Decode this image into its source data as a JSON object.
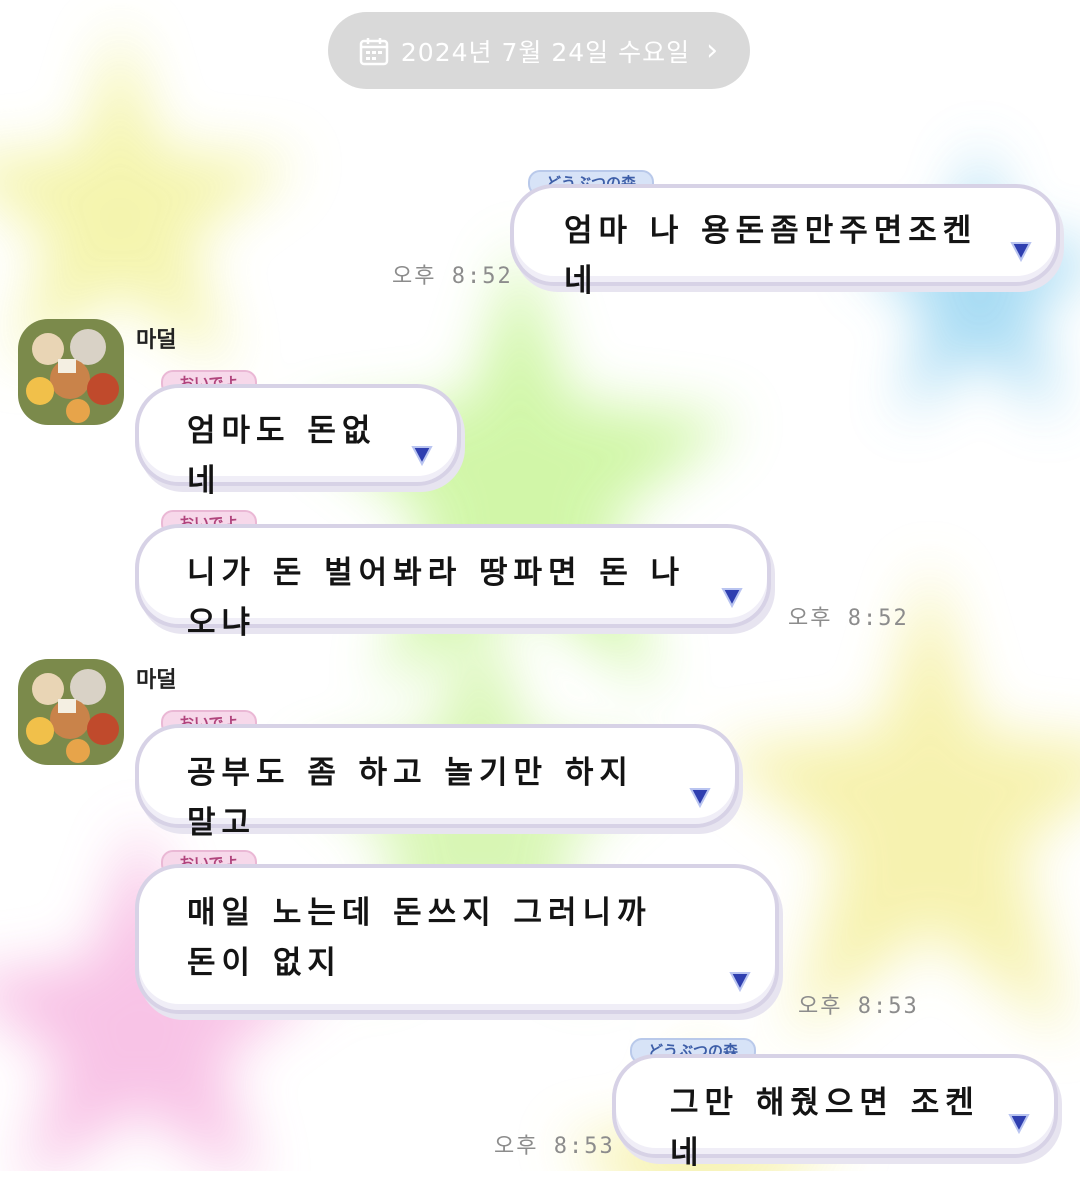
{
  "header": {
    "date_label": "2024년 7월 24일 수요일",
    "calendar_icon": "calendar-icon",
    "chevron_icon": "chevron-right-icon"
  },
  "colors": {
    "date_pill_bg": "#d9d9d9",
    "star_yellow": "#f3f3a0",
    "star_green": "#c9f59a",
    "star_blue": "#9ad6f2",
    "star_pink": "#f7b9e2",
    "tag_blue": "#3d5ea8",
    "tag_pink": "#b0437c",
    "indicator": "#2f3fb0"
  },
  "messages": [
    {
      "id": "m1",
      "side": "right",
      "tag": "どうぶつの森",
      "text": "엄마 나 용돈좀만주면조켄네",
      "time": "오후 8:52"
    },
    {
      "id": "m2",
      "side": "left",
      "sender": "마덜",
      "tag": "おいでよ",
      "text": "엄마도 돈없네"
    },
    {
      "id": "m3",
      "side": "left",
      "tag": "おいでよ",
      "text": "니가 돈 벌어봐라 땅파면 돈 나오냐",
      "time": "오후 8:52"
    },
    {
      "id": "m4",
      "side": "left",
      "sender": "마덜",
      "tag": "おいでよ",
      "text": "공부도 좀 하고 놀기만 하지 말고"
    },
    {
      "id": "m5",
      "side": "left",
      "tag": "おいでよ",
      "text": "매일 노는데 돈쓰지 그러니까 돈이 없지",
      "time": "오후 8:53"
    },
    {
      "id": "m6",
      "side": "right",
      "tag": "どうぶつの森",
      "text": "그만 해줬으면 조켄네",
      "time": "오후 8:53"
    }
  ]
}
